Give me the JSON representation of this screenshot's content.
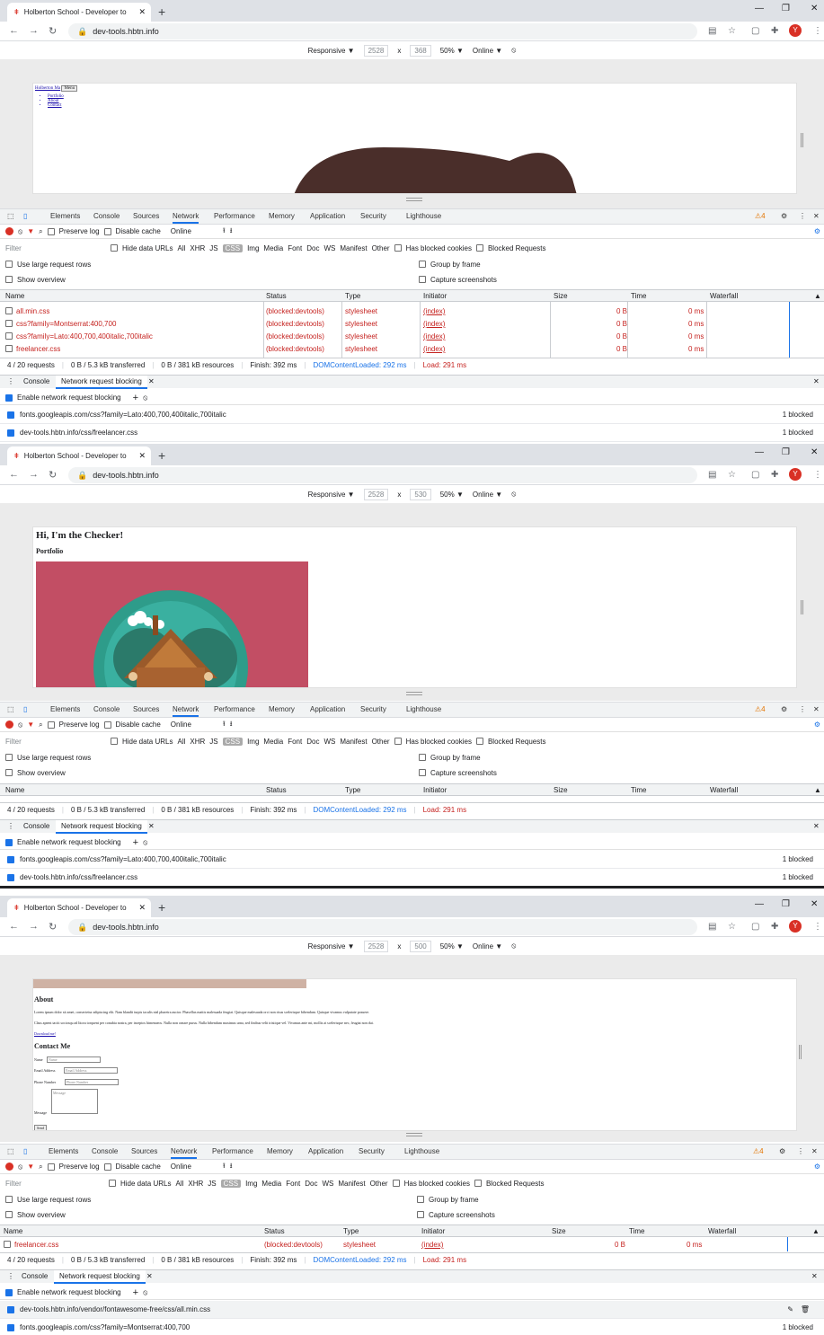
{
  "browser": {
    "tab_title": "Holberton School - Developer to",
    "url": "dev-tools.hbtn.info",
    "avatar": "Y"
  },
  "devbar": {
    "mode": "Responsive ▼",
    "width": "2528",
    "times": "x",
    "zoom": "50% ▼",
    "throttle": "Online ▼"
  },
  "devtools": {
    "tabs": [
      "Elements",
      "Console",
      "Sources",
      "Network",
      "Performance",
      "Memory",
      "Application",
      "Security",
      "Lighthouse"
    ],
    "warn": "⚠4",
    "preserve_log": "Preserve log",
    "disable_cache": "Disable cache",
    "online": "Online",
    "filter_placeholder": "Filter",
    "hide_data": "Hide data URLs",
    "types": [
      "All",
      "XHR",
      "JS",
      "CSS",
      "Img",
      "Media",
      "Font",
      "Doc",
      "WS",
      "Manifest",
      "Other"
    ],
    "has_blocked": "Has blocked cookies",
    "blocked_requests": "Blocked Requests",
    "large_rows": "Use large request rows",
    "group_frame": "Group by frame",
    "show_overview": "Show overview",
    "capture": "Capture screenshots",
    "cols": [
      "Name",
      "Status",
      "Type",
      "Initiator",
      "Size",
      "Time",
      "Waterfall"
    ],
    "status_bar": {
      "requests": "4 / 20 requests",
      "transferred": "0 B / 5.3 kB transferred",
      "resources": "0 B / 381 kB resources",
      "finish": "Finish: 392 ms",
      "dcl": "DOMContentLoaded: 292 ms",
      "load": "Load: 291 ms"
    },
    "drawer": {
      "console": "Console",
      "nrb": "Network request blocking",
      "enable": "Enable network request blocking"
    }
  },
  "panel1": {
    "height": "368",
    "page": {
      "brand": "Holberton Ma",
      "menu": "Menu",
      "links": [
        "Portfolio",
        "About",
        "Contact"
      ]
    },
    "rows": [
      {
        "name": "all.min.css",
        "status": "(blocked:devtools)",
        "type": "stylesheet",
        "init": "(index)",
        "size": "0 B",
        "time": "0 ms"
      },
      {
        "name": "css?family=Montserrat:400,700",
        "status": "(blocked:devtools)",
        "type": "stylesheet",
        "init": "(index)",
        "size": "0 B",
        "time": "0 ms"
      },
      {
        "name": "css?family=Lato:400,700,400italic,700italic",
        "status": "(blocked:devtools)",
        "type": "stylesheet",
        "init": "(index)",
        "size": "0 B",
        "time": "0 ms"
      },
      {
        "name": "freelancer.css",
        "status": "(blocked:devtools)",
        "type": "stylesheet",
        "init": "(index)",
        "size": "0 B",
        "time": "0 ms"
      }
    ],
    "blocked": [
      {
        "url": "fonts.googleapis.com/css?family=Lato:400,700,400italic,700italic",
        "count": "1 blocked"
      },
      {
        "url": "dev-tools.hbtn.info/css/freelancer.css",
        "count": "1 blocked"
      }
    ]
  },
  "panel2": {
    "height": "530",
    "page": {
      "h1": "Hi, I'm the Checker!",
      "h2": "Portfolio"
    },
    "blocked": [
      {
        "url": "fonts.googleapis.com/css?family=Lato:400,700,400italic,700italic",
        "count": "1 blocked"
      },
      {
        "url": "dev-tools.hbtn.info/css/freelancer.css",
        "count": "1 blocked"
      }
    ]
  },
  "panel3": {
    "height": "500",
    "page": {
      "about": "About",
      "p1": "Lorem ipsum dolor sit amet, consectetur adipiscing elit. Nam blandit turpis iaculis nisl pharetra auctor. Phasellus mattis malesuada feugiat. Quisque malesuada orci non risus scelerisque bibendum. Quisque vivamus vulputate posuere.",
      "p2": "Class aptent taciti sociosqu ad litora torquent per conubia nostra, per inceptos himenaeos. Nulla non ornare purus. Nulla bibendum maximus urna, sed finibus velit tristique vel. Vivamus ante mi, mollis at scelerisque nec, feugiat non dui.",
      "download": "Download me!",
      "contact": "Contact Me",
      "name_label": "Name",
      "name_ph": "Name",
      "email_label": "Email Address",
      "email_ph": "Email Address",
      "phone_label": "Phone Number",
      "phone_ph": "Phone Number",
      "msg_label": "Message",
      "msg_ph": "Message",
      "send": "Send"
    },
    "rows": [
      {
        "name": "freelancer.css",
        "status": "(blocked:devtools)",
        "type": "stylesheet",
        "init": "(index)",
        "size": "0 B",
        "time": "0 ms"
      }
    ],
    "blocked": [
      {
        "url": "dev-tools.hbtn.info/vendor/fontawesome-free/css/all.min.css",
        "count": ""
      },
      {
        "url": "fonts.googleapis.com/css?family=Montserrat:400,700",
        "count": "1 blocked"
      }
    ]
  }
}
